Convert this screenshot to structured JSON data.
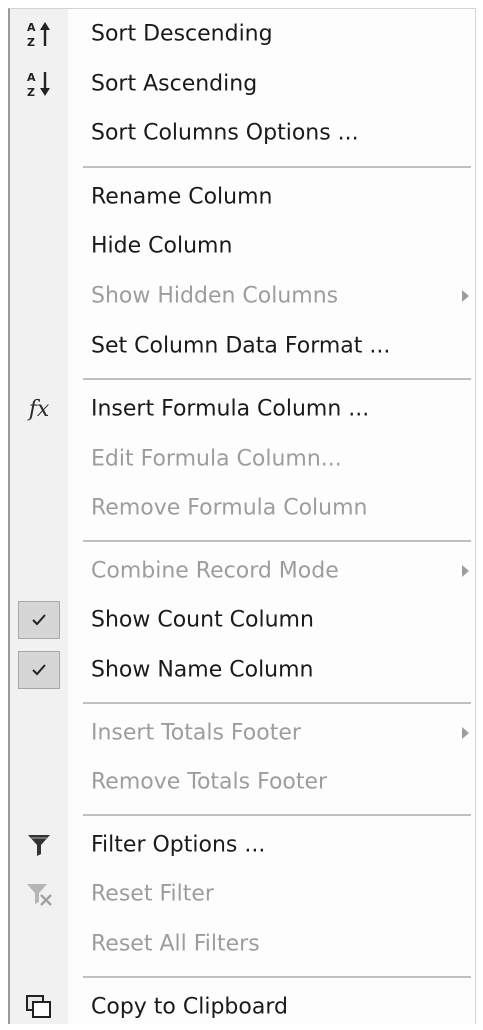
{
  "menu": {
    "items": [
      {
        "label": "Sort Descending",
        "icon": "sort-descending-icon",
        "disabled": false
      },
      {
        "label": "Sort Ascending",
        "icon": "sort-ascending-icon",
        "disabled": false
      },
      {
        "label": "Sort Columns Options ...",
        "disabled": false
      },
      {
        "label": "Rename Column",
        "disabled": false
      },
      {
        "label": "Hide Column",
        "disabled": false
      },
      {
        "label": "Show Hidden Columns",
        "disabled": true,
        "submenu": true
      },
      {
        "label": "Set Column Data Format ...",
        "disabled": false
      },
      {
        "label": "Insert Formula Column ...",
        "icon": "fx-icon",
        "icon_text": "fx",
        "disabled": false
      },
      {
        "label": "Edit Formula Column...",
        "disabled": true
      },
      {
        "label": "Remove Formula Column",
        "disabled": true
      },
      {
        "label": "Combine Record Mode",
        "disabled": true,
        "submenu": true
      },
      {
        "label": "Show Count Column",
        "checked": true,
        "disabled": false
      },
      {
        "label": "Show Name Column",
        "checked": true,
        "disabled": false
      },
      {
        "label": "Insert Totals Footer",
        "disabled": true,
        "submenu": true
      },
      {
        "label": "Remove Totals Footer",
        "disabled": true
      },
      {
        "label": "Filter Options ...",
        "icon": "funnel-icon",
        "disabled": false
      },
      {
        "label": "Reset Filter",
        "icon": "funnel-clear-icon",
        "disabled": true
      },
      {
        "label": "Reset All Filters",
        "disabled": true
      },
      {
        "label": "Copy to Clipboard",
        "icon": "copy-icon",
        "disabled": false
      }
    ]
  },
  "colors": {
    "text": "#1a1a1a",
    "disabled_text": "#9d9d9d",
    "gutter": "#f1f1f1",
    "separator": "#bfbfbf",
    "check_bg": "#d6d6d6"
  }
}
